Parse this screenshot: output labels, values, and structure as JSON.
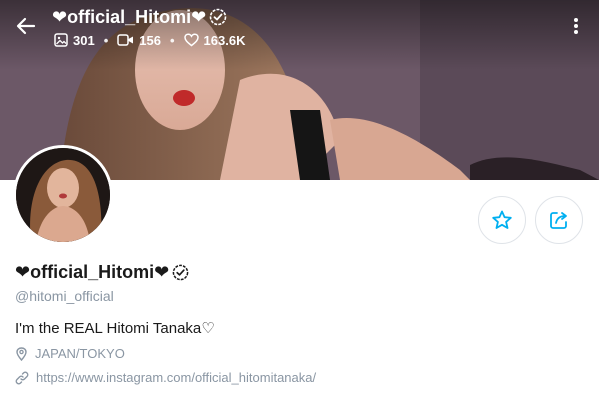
{
  "header": {
    "display_name": "❤official_Hitomi❤",
    "stats": {
      "photos": "301",
      "videos": "156",
      "likes": "163.6K"
    }
  },
  "profile": {
    "display_name": "❤official_Hitomi❤",
    "handle": "@hitomi_official",
    "bio": "I'm the REAL Hitomi Tanaka♡",
    "location": "JAPAN/TOKYO",
    "website": "https://www.instagram.com/official_hitomitanaka/"
  },
  "icons": {
    "back": "arrow-left-icon",
    "more": "more-vertical-icon",
    "photos": "image-icon",
    "videos": "video-icon",
    "likes": "heart-icon",
    "verified": "verified-badge-icon",
    "favorite": "star-icon",
    "share": "share-icon",
    "location": "location-pin-icon",
    "link": "link-icon"
  },
  "colors": {
    "accent": "#00aff0",
    "muted_text": "#8a96a3",
    "primary_text": "#1a1a1a"
  }
}
